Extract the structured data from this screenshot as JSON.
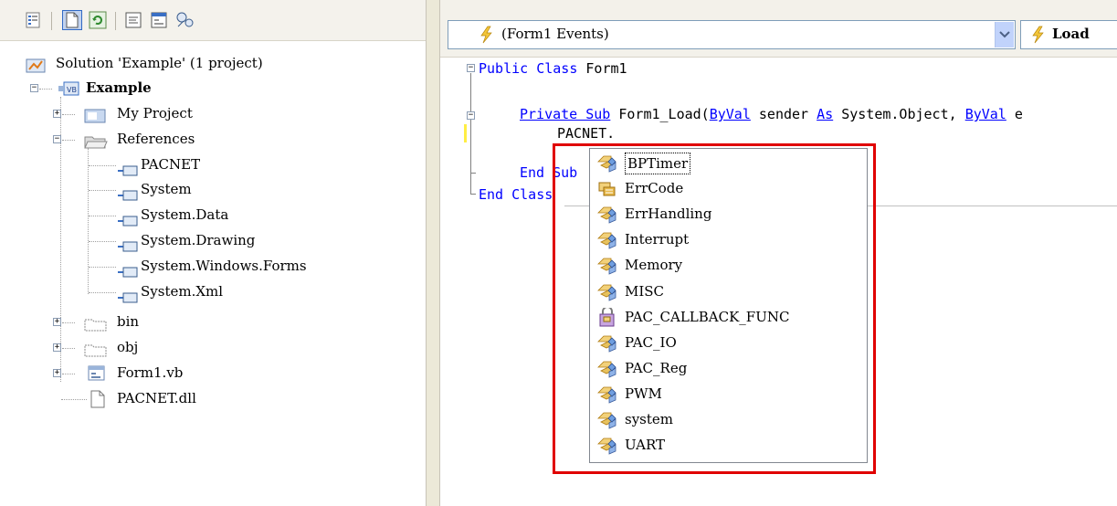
{
  "toolbar": {
    "buttons": [
      {
        "icon": "properties-icon"
      },
      {
        "icon": "show-all-files-icon"
      },
      {
        "icon": "refresh-icon"
      },
      {
        "icon": "view-code-icon"
      },
      {
        "icon": "view-designer-icon"
      },
      {
        "icon": "class-diagram-icon"
      }
    ]
  },
  "tree": {
    "solution": "Solution 'Example' (1 project)",
    "project": "Example",
    "my_project": "My Project",
    "references": "References",
    "refs": [
      "PACNET",
      "System",
      "System.Data",
      "System.Drawing",
      "System.Windows.Forms",
      "System.Xml"
    ],
    "bin": "bin",
    "obj": "obj",
    "form1": "Form1.vb",
    "dll": "PACNET.dll"
  },
  "editor": {
    "class_combo": "(Form1 Events)",
    "method_combo": "Load",
    "code": {
      "l1_kw": "Public Class",
      "l1_rest": " Form1",
      "l2_kw": "Private Sub",
      "l2_a": " Form1_Load(",
      "l2_byval1": "ByVal",
      "l2_b": " sender ",
      "l2_as": "As",
      "l2_c": " System.Object, ",
      "l2_byval2": "ByVal",
      "l2_d": " e",
      "l3": "PACNET.",
      "l4_kw": "End Sub",
      "l5_kw": "End Class"
    }
  },
  "intellisense": {
    "items": [
      {
        "label": "BPTimer",
        "icon": "namespace-icon",
        "selected": true
      },
      {
        "label": "ErrCode",
        "icon": "enum-icon"
      },
      {
        "label": "ErrHandling",
        "icon": "namespace-icon"
      },
      {
        "label": "Interrupt",
        "icon": "namespace-icon"
      },
      {
        "label": "Memory",
        "icon": "namespace-icon"
      },
      {
        "label": "MISC",
        "icon": "namespace-icon"
      },
      {
        "label": "PAC_CALLBACK_FUNC",
        "icon": "delegate-icon"
      },
      {
        "label": "PAC_IO",
        "icon": "namespace-icon"
      },
      {
        "label": "PAC_Reg",
        "icon": "namespace-icon"
      },
      {
        "label": "PWM",
        "icon": "namespace-icon"
      },
      {
        "label": "system",
        "icon": "namespace-icon"
      },
      {
        "label": "UART",
        "icon": "namespace-icon"
      }
    ]
  },
  "colors": {
    "highlight": "#e00000",
    "keyword": "#0000ff"
  }
}
